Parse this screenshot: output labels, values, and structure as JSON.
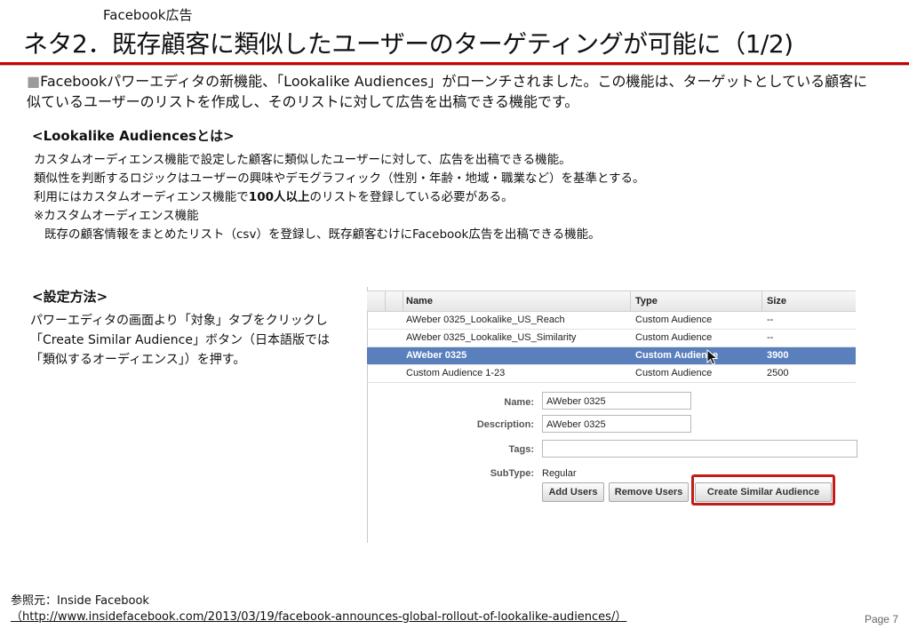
{
  "slide": {
    "subtitle": "Facebook広告",
    "title": "ネタ2．既存顧客に類似したユーザーのターゲティングが可能に（1/2)",
    "intro_bullet": "■",
    "intro_text": "Facebookパワーエディタの新機能、「Lookalike Audiences」がローンチされました。この機能は、ターゲットとしている顧客に似ているユーザーのリストを作成し、そのリストに対して広告を出稿できる機能です。",
    "section1": {
      "heading": "<Lookalike Audiencesとは>",
      "line1": "カスタムオーディエンス機能で設定した顧客に類似したユーザーに対して、広告を出稿できる機能。",
      "line2": "類似性を判断するロジックはユーザーの興味やデモグラフィック（性別・年齢・地域・職業など）を基準とする。",
      "line3_pre": "利用にはカスタムオーディエンス機能で",
      "line3_bold": "100人以上",
      "line3_post": "のリストを登録している必要がある。",
      "line4": "※カスタムオーディエンス機能",
      "line5": "既存の顧客情報をまとめたリスト（csv）を登録し、既存顧客むけにFacebook広告を出稿できる機能。"
    },
    "section2": {
      "heading": "<設定方法>",
      "body": "パワーエディタの画面より「対象」タブをクリックし「Create Similar Audience」ボタン（日本語版では「類似するオーディエンス」）を押す。"
    },
    "reference_label": "参照元：Inside Facebook",
    "reference_url": "（http://www.insidefacebook.com/2013/03/19/facebook-announces-global-rollout-of-lookalike-audiences/）",
    "page_number": "Page 7"
  },
  "screenshot": {
    "columns": [
      "Name",
      "Type",
      "Size"
    ],
    "rows": [
      {
        "name": "AWeber 0325_Lookalike_US_Reach",
        "type": "Custom Audience",
        "size": "--"
      },
      {
        "name": "AWeber 0325_Lookalike_US_Similarity",
        "type": "Custom Audience",
        "size": "--"
      },
      {
        "name": "AWeber 0325",
        "type": "Custom Audience",
        "size": "3900"
      },
      {
        "name": "Custom Audience 1-23",
        "type": "Custom Audience",
        "size": "2500"
      }
    ],
    "selected_row_index": 2,
    "form": {
      "name_label": "Name:",
      "name_value": "AWeber 0325",
      "description_label": "Description:",
      "description_value": "AWeber 0325",
      "tags_label": "Tags:",
      "tags_value": "",
      "subtype_label": "SubType:",
      "subtype_value": "Regular"
    },
    "buttons": {
      "add_users": "Add Users",
      "remove_users": "Remove Users",
      "create_similar": "Create Similar Audience"
    },
    "colors": {
      "selected_row": "#5a7fbd",
      "highlight_border": "#c41a1a",
      "title_rule": "#cc0000"
    }
  }
}
